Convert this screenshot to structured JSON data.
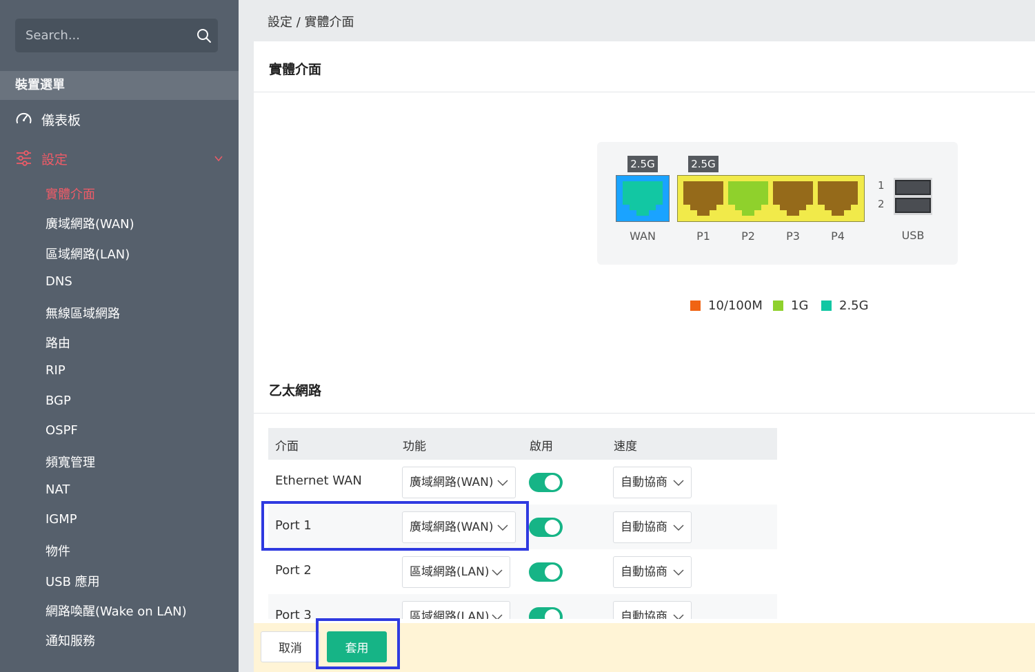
{
  "sidebar": {
    "search_placeholder": "Search...",
    "menu_header": "裝置選單",
    "dashboard_label": "儀表板",
    "settings_label": "設定",
    "sub_items": [
      "實體介面",
      "廣域網路(WAN)",
      "區域網路(LAN)",
      "DNS",
      "無線區域網路",
      "路由",
      "RIP",
      "BGP",
      "OSPF",
      "頻寬管理",
      "NAT",
      "IGMP",
      "物件",
      "USB 應用",
      "網路喚醒(Wake on LAN)",
      "通知服務"
    ],
    "active_sub_item": "實體介面"
  },
  "breadcrumb": "設定 / 實體介面",
  "panel_title": "實體介面",
  "device": {
    "wan_speed_tag": "2.5G",
    "lan_speed_tag": "2.5G",
    "port_labels": [
      "WAN",
      "P1",
      "P2",
      "P3",
      "P4"
    ],
    "usb_label": "USB",
    "usb_numbers": [
      "1",
      "2"
    ],
    "port_colors": {
      "wan_bg": "#1aa3ff",
      "wan_jack": "#12c7a3",
      "group_bg": "#f1ea4a",
      "jack_10_100": "#956a1a",
      "jack_1g": "#8fd12c"
    }
  },
  "legend": [
    {
      "label": "10/100M",
      "color": "#f06414"
    },
    {
      "label": "1G",
      "color": "#8fd12c"
    },
    {
      "label": "2.5G",
      "color": "#12c7a3"
    }
  ],
  "section_title": "乙太網路",
  "table": {
    "headers": [
      "介面",
      "功能",
      "啟用",
      "速度"
    ],
    "rows": [
      {
        "interface": "Ethernet WAN",
        "function": "廣域網路(WAN)",
        "enabled": true,
        "speed": "自動協商"
      },
      {
        "interface": "Port 1",
        "function": "廣域網路(WAN)",
        "enabled": true,
        "speed": "自動協商"
      },
      {
        "interface": "Port 2",
        "function": "區域網路(LAN)",
        "enabled": true,
        "speed": "自動協商"
      },
      {
        "interface": "Port 3",
        "function": "區域網路(LAN)",
        "enabled": true,
        "speed": "自動協商"
      }
    ]
  },
  "footer": {
    "cancel_label": "取消",
    "apply_label": "套用"
  }
}
